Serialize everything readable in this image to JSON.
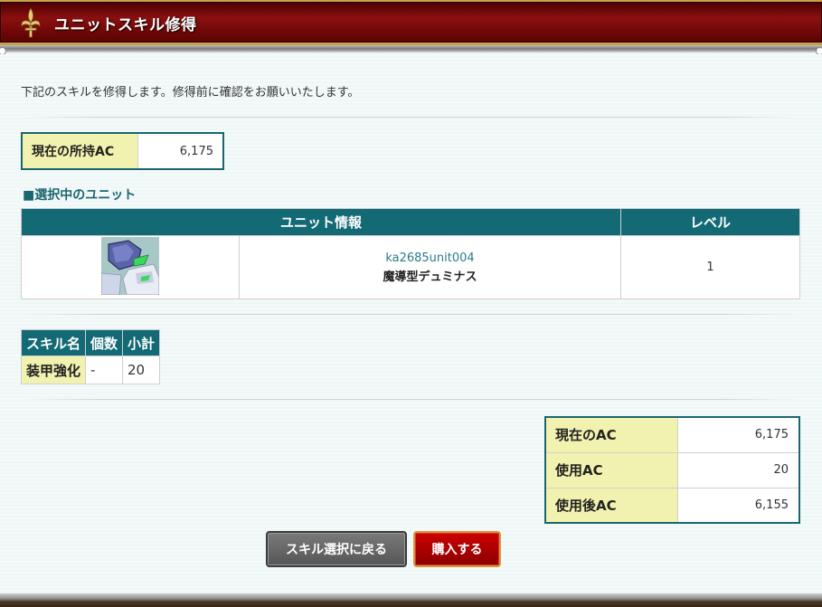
{
  "header": {
    "title": "ユニットスキル修得",
    "emblem_icon": "fleur-de-lis-icon"
  },
  "intro_text": "下記のスキルを修得します。修得前に確認をお願いいたします。",
  "current_ac": {
    "label": "現在の所持AC",
    "value": "6,175"
  },
  "selected_unit": {
    "section_title": "■選択中のユニット",
    "headers": {
      "info": "ユニット情報",
      "level": "レベル"
    },
    "unit": {
      "id": "ka2685unit004",
      "name": "魔導型デュミナス",
      "level": "1",
      "thumbnail_icon": "mecha-unit-thumbnail"
    }
  },
  "skill_table": {
    "headers": {
      "name": "スキル名",
      "count": "個数",
      "subtotal": "小計"
    },
    "row": {
      "name": "装甲強化",
      "count": "-",
      "subtotal": "20"
    }
  },
  "summary": {
    "current_label": "現在のAC",
    "current_value": "6,175",
    "used_label": "使用AC",
    "used_value": "20",
    "after_label": "使用後AC",
    "after_value": "6,155"
  },
  "buttons": {
    "back": "スキル選択に戻る",
    "buy": "購入する"
  },
  "colors": {
    "accent": "#136a75",
    "label_bg": "#f2f2b0",
    "header_red": "#8b0f0f",
    "buy_red": "#cc0000"
  }
}
